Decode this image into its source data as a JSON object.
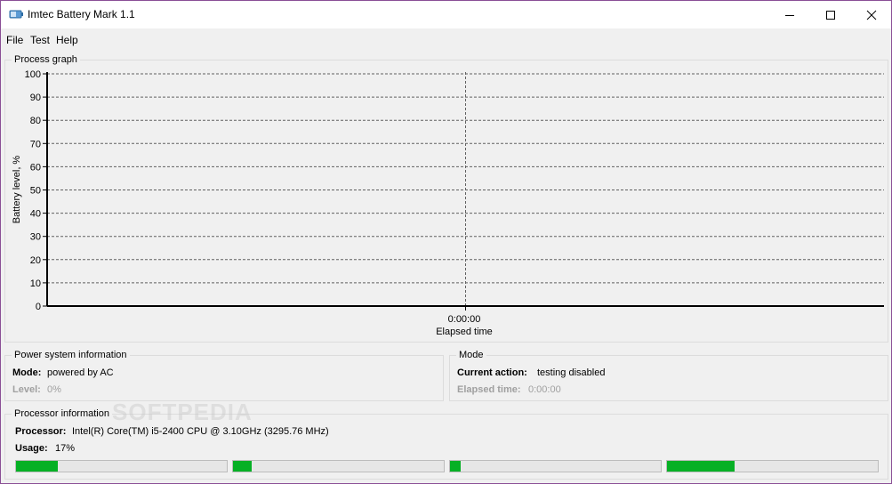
{
  "window": {
    "title": "Imtec Battery Mark 1.1"
  },
  "menu": {
    "items": [
      "File",
      "Test",
      "Help"
    ]
  },
  "graph": {
    "group_title": "Process graph",
    "ylabel": "Battery level, %",
    "xlabel": "Elapsed time",
    "x_tick": "0:00:00",
    "y_ticks": [
      "0",
      "10",
      "20",
      "30",
      "40",
      "50",
      "60",
      "70",
      "80",
      "90",
      "100"
    ]
  },
  "chart_data": {
    "type": "line",
    "title": "",
    "xlabel": "Elapsed time",
    "ylabel": "Battery level, %",
    "x_ticks": [
      "0:00:00"
    ],
    "ylim": [
      0,
      100
    ],
    "grid": true,
    "series": []
  },
  "power": {
    "group_title": "Power system information",
    "mode_label": "Mode:",
    "mode_value": "powered by AC",
    "level_label": "Level:",
    "level_value": "0%"
  },
  "mode": {
    "group_title": "Mode",
    "action_label": "Current action:",
    "action_value": "testing disabled",
    "elapsed_label": "Elapsed time:",
    "elapsed_value": "0:00:00"
  },
  "processor": {
    "group_title": "Processor information",
    "processor_label": "Processor:",
    "processor_value": "Intel(R) Core(TM) i5-2400 CPU @ 3.10GHz  (3295.76 MHz)",
    "usage_label": "Usage:",
    "usage_value": "17%",
    "core_usage": [
      0.2,
      0.09,
      0.05,
      0.32
    ]
  },
  "watermark": "SOFTPEDIA",
  "colors": {
    "progress": "#06b025",
    "window_border": "#8a4f96"
  }
}
